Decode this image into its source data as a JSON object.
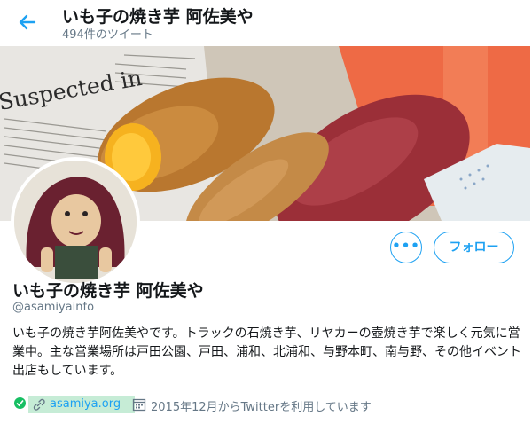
{
  "header": {
    "title": "いも子の焼き芋 阿佐美や",
    "tweet_count": "494件のツイート"
  },
  "profile": {
    "name": "いも子の焼き芋 阿佐美や",
    "handle": "@asamiyainfo",
    "bio": "いも子の焼き芋阿佐美やです。トラックの石焼き芋、リヤカーの壺焼き芋で楽しく元気に営業中。主な営業場所は戸田公園、戸田、浦和、北浦和、与野本町、南与野、その他イベント出店もしています。",
    "website": "asamiya.org",
    "joined": "2015年12月からTwitterを利用しています"
  },
  "actions": {
    "more_label": "•••",
    "follow_label": "フォロー"
  },
  "banner": {
    "newspaper_text": "Suspected in"
  },
  "colors": {
    "accent": "#1da1f2",
    "verified": "#17bf63",
    "muted": "#657786"
  },
  "icons": [
    "back-arrow-icon",
    "more-icon",
    "check-icon",
    "link-icon",
    "calendar-icon"
  ]
}
